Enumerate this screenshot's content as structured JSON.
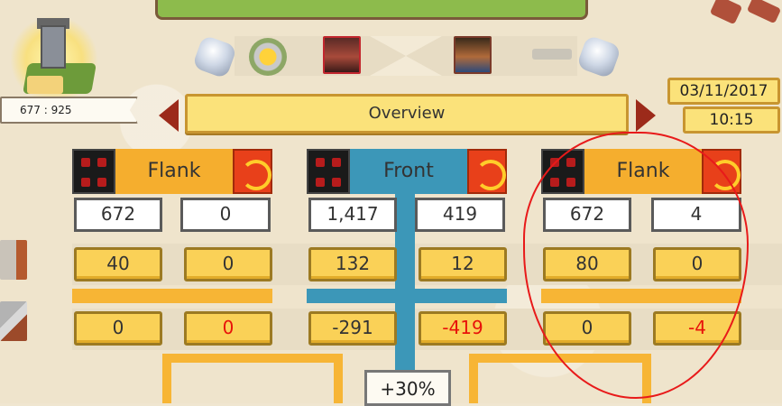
{
  "player": {
    "coords": "677 : 925"
  },
  "datetime": {
    "date": "03/11/2017",
    "time": "10:15"
  },
  "nav": {
    "title": "Overview"
  },
  "columns": [
    {
      "name": "Flank",
      "stat_a": "672",
      "stat_b": "0",
      "row1_a": "40",
      "row1_b": "0",
      "row2_a": "0",
      "row2_b": "0"
    },
    {
      "name": "Front",
      "stat_a": "1,417",
      "stat_b": "419",
      "row1_a": "132",
      "row1_b": "12",
      "row2_a": "-291",
      "row2_b": "-419"
    },
    {
      "name": "Flank",
      "stat_a": "672",
      "stat_b": "4",
      "row1_a": "80",
      "row1_b": "0",
      "row2_a": "0",
      "row2_b": "-4"
    }
  ],
  "bonus": "+30%",
  "colors": {
    "accent_yellow": "#f5ae2e",
    "front_blue": "#3c97b8",
    "negative_red": "#e8120a",
    "annotation_red": "#e81a1a"
  },
  "icons": [
    "castle-icon",
    "gem-icon",
    "sun-laurel-icon",
    "attacker-portrait",
    "defender-portrait",
    "sword-icon",
    "prev-arrow-icon",
    "next-arrow-icon",
    "enemy-units-icon",
    "fire-emblem-icon",
    "wall-icon",
    "siege-tool-icon"
  ]
}
